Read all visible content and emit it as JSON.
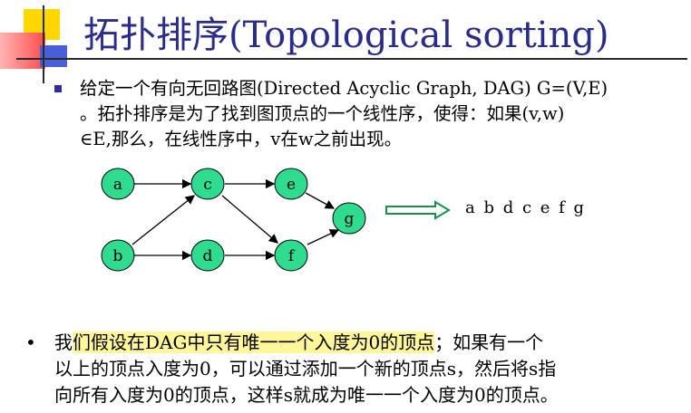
{
  "slide": {
    "title": "拓扑排序(Topological sorting)",
    "definition_lines": [
      "给定一个有向无回路图(Directed Acyclic Graph, DAG) G=(V,E)",
      "。拓扑排序是为了找到图顶点的一个线性序，使得：如果(v,w)",
      "∈E,那么，在线性序中，v在w之前出现。"
    ],
    "graph": {
      "nodes": [
        "a",
        "b",
        "c",
        "d",
        "e",
        "f",
        "g"
      ],
      "edges": [
        [
          "a",
          "c"
        ],
        [
          "b",
          "c"
        ],
        [
          "b",
          "d"
        ],
        [
          "c",
          "e"
        ],
        [
          "c",
          "f"
        ],
        [
          "d",
          "f"
        ],
        [
          "e",
          "g"
        ],
        [
          "f",
          "g"
        ]
      ],
      "node_color": "#2fdc8f"
    },
    "order": "a b  d c e f g",
    "note": {
      "bullet": "•",
      "line1_highlighted": "们假设在DAG中只有唯一一个入度为0的顶点",
      "line1_prefix": "我",
      "line1_suffix": "；如果有一个",
      "line2": "以上的顶点入度为0，可以通过添加一个新的顶点s，然后将s指",
      "line3": "向所有入度为0的顶点，这样s就成为唯一一个入度为0的顶点。"
    }
  }
}
